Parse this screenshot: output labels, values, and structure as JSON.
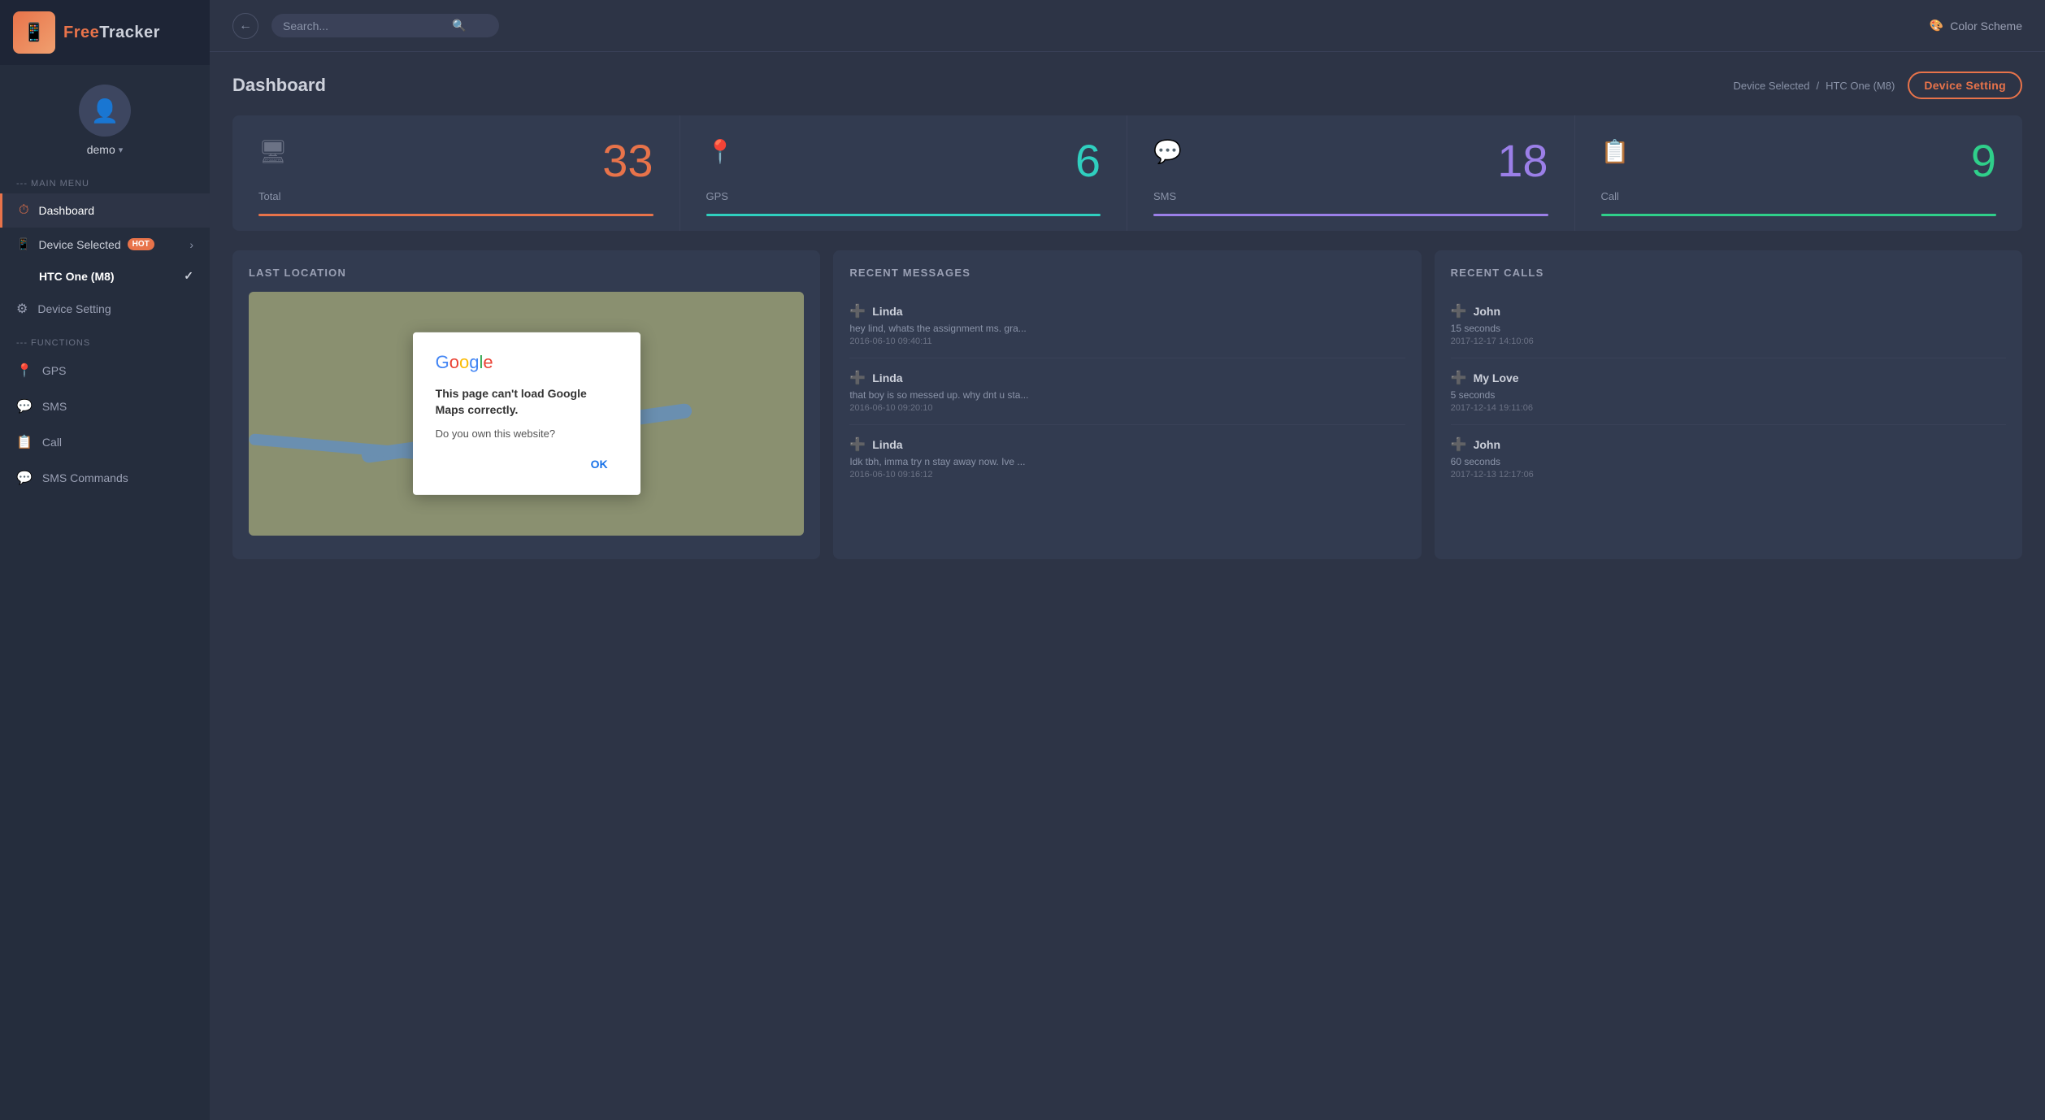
{
  "app": {
    "name": "FreeTracker",
    "name_part1": "Free",
    "name_part2": "Tracker"
  },
  "topbar": {
    "search_placeholder": "Search...",
    "color_scheme_label": "Color Scheme"
  },
  "user": {
    "name": "demo",
    "avatar_icon": "👤"
  },
  "sidebar": {
    "main_menu_label": "--- MAIN MENU",
    "functions_label": "--- FUNCTIONS",
    "items": [
      {
        "id": "dashboard",
        "label": "Dashboard",
        "icon": "⏱",
        "active": true
      },
      {
        "id": "device-selected",
        "label": "Device Selected",
        "badge": "HOT"
      },
      {
        "id": "device-name",
        "label": "HTC One (M8)"
      },
      {
        "id": "device-setting",
        "label": "Device Setting",
        "icon": "⚙"
      },
      {
        "id": "gps",
        "label": "GPS",
        "icon": "📍"
      },
      {
        "id": "sms",
        "label": "SMS",
        "icon": "💬"
      },
      {
        "id": "call",
        "label": "Call",
        "icon": "📞"
      },
      {
        "id": "sms-commands",
        "label": "SMS Commands",
        "icon": "💬"
      }
    ]
  },
  "page": {
    "title": "Dashboard",
    "breadcrumb_device_selected": "Device Selected",
    "breadcrumb_separator": "/",
    "breadcrumb_device_name": "HTC One (M8)",
    "device_setting_btn": "Device Setting"
  },
  "stats": [
    {
      "id": "total",
      "label": "Total",
      "value": "33",
      "color": "orange",
      "icon": "🖥"
    },
    {
      "id": "gps",
      "label": "GPS",
      "value": "6",
      "color": "teal",
      "icon": "📍"
    },
    {
      "id": "sms",
      "label": "SMS",
      "value": "18",
      "color": "purple",
      "icon": "💬"
    },
    {
      "id": "call",
      "label": "Call",
      "value": "9",
      "color": "green",
      "icon": "📋"
    }
  ],
  "last_location": {
    "title": "LAST LOCATION",
    "map_error_logo": "Google",
    "map_error_message": "This page can't load Google Maps correctly.",
    "map_error_question": "Do you own this website?",
    "map_error_ok": "OK"
  },
  "recent_messages": {
    "title": "RECENT MESSAGES",
    "items": [
      {
        "sender": "Linda",
        "text": "hey lind, whats the assignment ms. gra...",
        "time": "2016-06-10 09:40:11"
      },
      {
        "sender": "Linda",
        "text": "that boy is so messed up. why dnt u sta...",
        "time": "2016-06-10 09:20:10"
      },
      {
        "sender": "Linda",
        "text": "Idk tbh, imma try n stay away now. Ive ...",
        "time": "2016-06-10 09:16:12"
      }
    ]
  },
  "recent_calls": {
    "title": "RECENT CALLS",
    "items": [
      {
        "name": "John",
        "duration": "15 seconds",
        "time": "2017-12-17 14:10:06"
      },
      {
        "name": "My Love",
        "duration": "5 seconds",
        "time": "2017-12-14 19:11:06"
      },
      {
        "name": "John",
        "duration": "60 seconds",
        "time": "2017-12-13 12:17:06"
      }
    ]
  }
}
